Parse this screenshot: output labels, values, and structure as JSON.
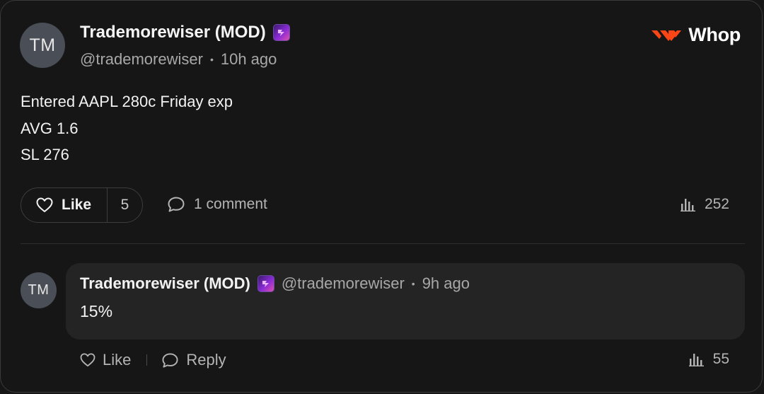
{
  "post": {
    "author_initials": "TM",
    "author_name": "Trademorewiser (MOD)",
    "handle": "@trademorewiser",
    "separator": "•",
    "time": "10h ago",
    "body_lines": [
      "Entered AAPL 280c Friday exp",
      "AVG 1.6",
      "SL 276"
    ],
    "like_label": "Like",
    "like_count": "5",
    "comment_label": "1 comment",
    "view_count": "252"
  },
  "brand": {
    "name": "Whop",
    "icon": "whop-logo-icon",
    "color": "#fa4616"
  },
  "comment": {
    "author_initials": "TM",
    "author_name": "Trademorewiser (MOD)",
    "handle": "@trademorewiser",
    "separator": "•",
    "time": "9h ago",
    "text": "15%",
    "like_label": "Like",
    "reply_label": "Reply",
    "view_count": "55"
  },
  "icons": {
    "badge": "mod-badge-icon",
    "like": "heart-icon",
    "comment": "comment-bubble-icon",
    "views": "bar-chart-icon",
    "reply": "reply-bubble-icon"
  }
}
